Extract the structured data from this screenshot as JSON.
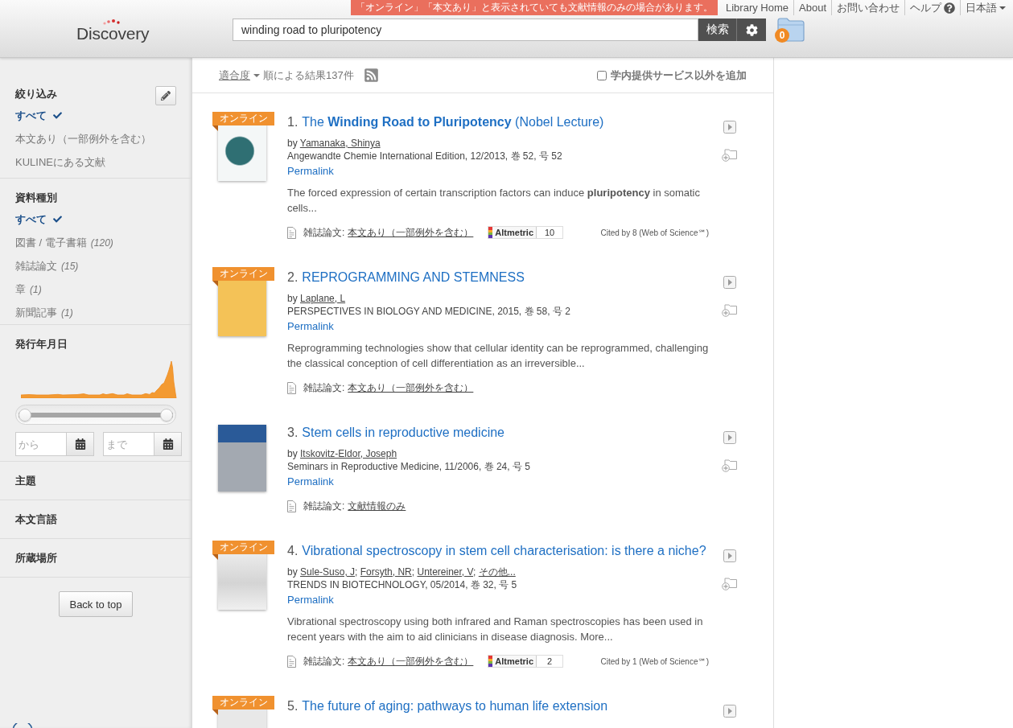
{
  "header": {
    "logo": "Discovery",
    "notice": "「オンライン」「本文あり」と表示されていても文献情報のみの場合があります。",
    "links": [
      {
        "label": "Library Home",
        "kind": "link"
      },
      {
        "label": "About",
        "kind": "link"
      },
      {
        "label": "お問い合わせ",
        "kind": "link"
      },
      {
        "label": "ヘルプ",
        "kind": "help"
      },
      {
        "label": "日本語",
        "kind": "menu"
      }
    ],
    "search": {
      "value": "winding road to pluripotency",
      "button": "検索"
    },
    "folder_count": "0"
  },
  "sidebar": {
    "sections": [
      {
        "title": "絞り込み",
        "kind": "filter",
        "items": [
          {
            "label": "すべて",
            "selected": true
          },
          {
            "label": "本文あり（一部例外を含む）",
            "selected": false
          },
          {
            "label": "KULINEにある文献",
            "selected": false
          }
        ]
      },
      {
        "title": "資料種別",
        "kind": "list",
        "items": [
          {
            "label": "すべて",
            "selected": true
          },
          {
            "label": "図書 / 電子書籍",
            "count": "(120)",
            "selected": false
          },
          {
            "label": "雑誌論文",
            "count": "(15)",
            "selected": false
          },
          {
            "label": "章",
            "count": "(1)",
            "selected": false
          },
          {
            "label": "新聞記事",
            "count": "(1)",
            "selected": false
          }
        ]
      },
      {
        "title": "発行年月日",
        "kind": "date",
        "slider": {
          "level": 1
        },
        "from_placeholder": "から",
        "to_placeholder": "まで"
      },
      {
        "title": "主題",
        "kind": "collapsed"
      },
      {
        "title": "本文言語",
        "kind": "collapsed"
      },
      {
        "title": "所蔵場所",
        "kind": "collapsed"
      }
    ],
    "back_to_top": "Back to top"
  },
  "results_bar": {
    "sort": "適合度",
    "summary": "順による結果137件",
    "include_external": {
      "label": "学内提供サービス以外を追加",
      "checked": false
    }
  },
  "author_separator": ";",
  "results": [
    {
      "number": "1.",
      "badge": "オンライン",
      "title": "The **Winding Road to Pluripotency** (Nobel Lecture)",
      "by": "by",
      "authors": [
        "Yamanaka, Shinya"
      ],
      "source": "Angewandte Chemie International Edition, 12/2013, 巻 52, 号 52",
      "permalink": "Permalink",
      "abstract": "The forced expression of certain transcription factors can induce **pluripotency** in somatic cells...",
      "format": "雑誌論文:",
      "availability": "本文あり（一部例外を含む）",
      "altmetric": {
        "label": "Altmetric",
        "score": "10"
      },
      "cited": "Cited by 8 (Web of Science℠)",
      "tools": [
        {
          "kind": "preview"
        },
        {
          "kind": "add-folder"
        }
      ]
    },
    {
      "number": "2.",
      "badge": "オンライン",
      "title": "REPROGRAMMING AND STEMNESS",
      "by": "by",
      "authors": [
        "Laplane, L"
      ],
      "source": "PERSPECTIVES IN BIOLOGY AND MEDICINE, 2015, 巻 58, 号 2",
      "permalink": "Permalink",
      "abstract": "Reprogramming technologies show that cellular identity can be reprogrammed, challenging the classical conception of cell differentiation as an irreversible...",
      "format": "雑誌論文:",
      "availability": "本文あり（一部例外を含む）",
      "tools": [
        {
          "kind": "preview"
        },
        {
          "kind": "add-folder"
        }
      ]
    },
    {
      "number": "3.",
      "title": "Stem cells in reproductive medicine",
      "by": "by",
      "authors": [
        "Itskovitz-Eldor, Joseph"
      ],
      "source": "Seminars in Reproductive Medicine, 11/2006, 巻 24, 号 5",
      "permalink": "Permalink",
      "format": "雑誌論文:",
      "availability": "文献情報のみ",
      "tools": [
        {
          "kind": "preview"
        },
        {
          "kind": "add-folder"
        }
      ]
    },
    {
      "number": "4.",
      "badge": "オンライン",
      "title": "Vibrational spectroscopy in stem cell characterisation: is there a niche?",
      "by": "by",
      "authors": [
        "Sule-Suso, J",
        "Forsyth, NR",
        "Untereiner, V",
        "その他..."
      ],
      "source": "TRENDS IN BIOTECHNOLOGY, 05/2014, 巻 32, 号 5",
      "permalink": "Permalink",
      "abstract": "Vibrational spectroscopy using both infrared and Raman spectroscopies has been used in recent years with the aim to aid clinicians in disease diagnosis. More...",
      "format": "雑誌論文:",
      "availability": "本文あり（一部例外を含む）",
      "altmetric": {
        "label": "Altmetric",
        "score": "2"
      },
      "cited": "Cited by 1 (Web of Science℠)",
      "tools": [
        {
          "kind": "preview"
        },
        {
          "kind": "add-folder"
        }
      ]
    },
    {
      "number": "5.",
      "badge": "オンライン",
      "title": "The future of aging: pathways to human life extension",
      "tools": [
        {
          "kind": "preview"
        }
      ]
    }
  ]
}
